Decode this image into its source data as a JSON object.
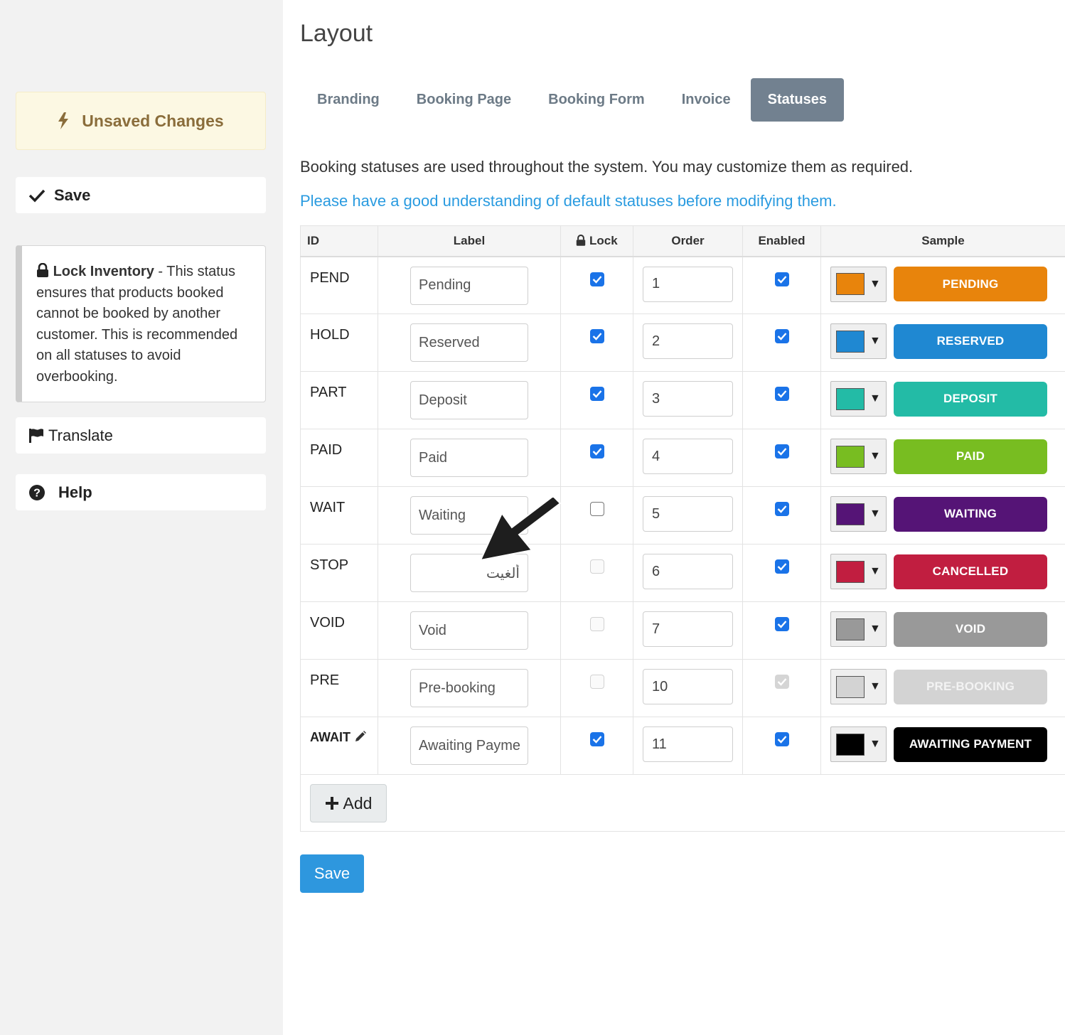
{
  "sidebar": {
    "unsaved_label": "Unsaved Changes",
    "save_label": "Save",
    "info": {
      "title": "Lock Inventory",
      "text": " - This status ensures that products booked cannot be booked by another customer. This is recommended on all statuses to avoid overbooking."
    },
    "translate_label": "Translate",
    "help_label": "Help"
  },
  "page": {
    "title": "Layout",
    "tabs": [
      {
        "label": "Branding",
        "active": false
      },
      {
        "label": "Booking Page",
        "active": false
      },
      {
        "label": "Booking Form",
        "active": false
      },
      {
        "label": "Invoice",
        "active": false
      },
      {
        "label": "Statuses",
        "active": true
      }
    ],
    "description": "Booking statuses are used throughout the system. You may customize them as required.",
    "warning_link": "Please have a good understanding of default statuses before modifying them."
  },
  "table": {
    "headers": {
      "id": "ID",
      "label": "Label",
      "lock": "Lock",
      "order": "Order",
      "enabled": "Enabled",
      "sample": "Sample"
    },
    "rows": [
      {
        "id": "PEND",
        "label": "Pending",
        "lock": true,
        "lock_disabled": false,
        "order": "1",
        "enabled": true,
        "enabled_disabled": false,
        "color": "#e8840c",
        "sample": "PENDING",
        "sample_text_color": "#ffffff"
      },
      {
        "id": "HOLD",
        "label": "Reserved",
        "lock": true,
        "lock_disabled": false,
        "order": "2",
        "enabled": true,
        "enabled_disabled": false,
        "color": "#1f88d2",
        "sample": "RESERVED",
        "sample_text_color": "#ffffff"
      },
      {
        "id": "PART",
        "label": "Deposit",
        "lock": true,
        "lock_disabled": false,
        "order": "3",
        "enabled": true,
        "enabled_disabled": false,
        "color": "#23bba6",
        "sample": "DEPOSIT",
        "sample_text_color": "#ffffff"
      },
      {
        "id": "PAID",
        "label": "Paid",
        "lock": true,
        "lock_disabled": false,
        "order": "4",
        "enabled": true,
        "enabled_disabled": false,
        "color": "#78bd21",
        "sample": "PAID",
        "sample_text_color": "#ffffff"
      },
      {
        "id": "WAIT",
        "label": "Waiting",
        "lock": false,
        "lock_disabled": false,
        "order": "5",
        "enabled": true,
        "enabled_disabled": false,
        "color": "#551476",
        "sample": "WAITING",
        "sample_text_color": "#ffffff"
      },
      {
        "id": "STOP",
        "label": "ألغيت",
        "lock": false,
        "lock_disabled": true,
        "order": "6",
        "enabled": true,
        "enabled_disabled": false,
        "color": "#c11e40",
        "sample": "CANCELLED",
        "sample_text_color": "#ffffff"
      },
      {
        "id": "VOID",
        "label": "Void",
        "lock": false,
        "lock_disabled": true,
        "order": "7",
        "enabled": true,
        "enabled_disabled": false,
        "color": "#999999",
        "sample": "VOID",
        "sample_text_color": "#ffffff"
      },
      {
        "id": "PRE",
        "label": "Pre-booking",
        "lock": false,
        "lock_disabled": true,
        "order": "10",
        "enabled": true,
        "enabled_disabled": true,
        "color": "#d3d3d3",
        "sample": "PRE-BOOKING",
        "sample_text_color": "#f3f3f3"
      },
      {
        "id": "AWAIT",
        "label": "Awaiting Payme",
        "lock": true,
        "lock_disabled": false,
        "order": "11",
        "enabled": true,
        "enabled_disabled": false,
        "color": "#000000",
        "sample": "AWAITING PAYMENT",
        "sample_text_color": "#ffffff",
        "editable_id": true
      }
    ],
    "add_label": "Add"
  },
  "save_button_label": "Save"
}
